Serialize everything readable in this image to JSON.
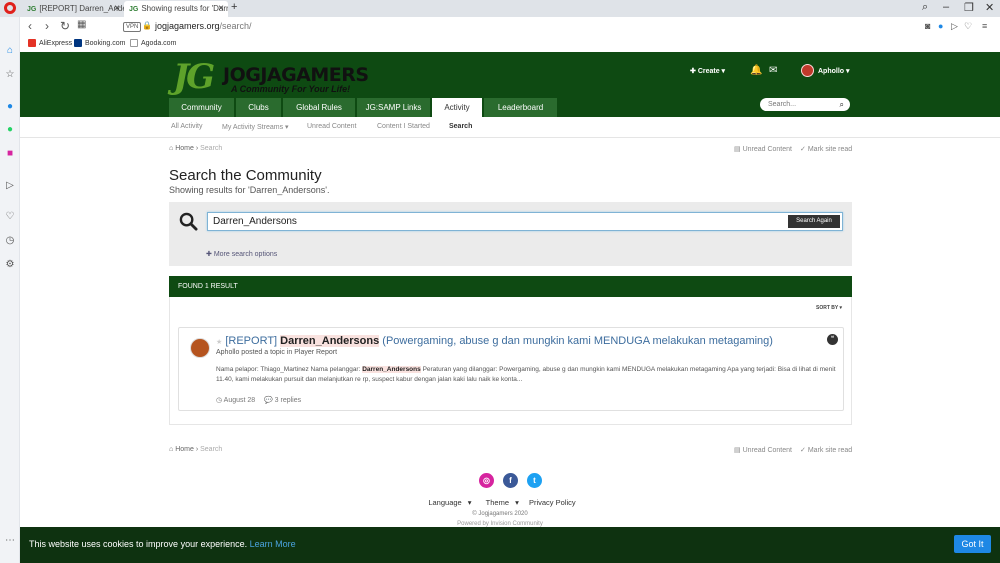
{
  "browser": {
    "tabs": [
      {
        "title": "[REPORT] Darren_Anderso"
      },
      {
        "title": "Showing results for 'Darre"
      }
    ],
    "new_tab": "+",
    "address": {
      "vpn": "VPN",
      "domain": "jogjagamers.org",
      "path": "/search/"
    },
    "bookmarks": [
      "AliExpress",
      "Booking.com",
      "Agoda.com"
    ]
  },
  "site": {
    "logo_mark": "JG",
    "logo_name": "JOGJAGAMERS",
    "logo_tagline": "A Community For Your Life!",
    "create_label": "Create",
    "username": "Aphollo",
    "nav_tabs": [
      "Community",
      "Clubs",
      "Global Rules",
      "JG:SAMP Links",
      "Activity",
      "Leaderboard"
    ],
    "active_tab": "Activity",
    "search_placeholder": "Search...",
    "subnav": [
      "All Activity",
      "My Activity Streams",
      "Unread Content",
      "Content I Started",
      "Search"
    ],
    "active_subnav": "Search"
  },
  "page": {
    "breadcrumb_home": "Home",
    "breadcrumb_current": "Search",
    "unread_content": "Unread Content",
    "mark_site_read": "Mark site read",
    "title": "Search the Community",
    "subtitle": "Showing results for 'Darren_Andersons'.",
    "search_value": "Darren_Andersons",
    "search_again": "Search Again",
    "more_options": "More search options",
    "found_label": "FOUND 1 RESULT",
    "sort_label": "SORT BY"
  },
  "result": {
    "prefix": "[REPORT]",
    "highlight": "Darren_Andersons",
    "title_rest": "(Powergaming, abuse g dan mungkin kami MENDUGA melakukan metagaming)",
    "meta": "Aphollo posted a topic in Player Report",
    "snippet_before": "Nama pelapor: Thiago_Martinez Nama pelanggar:",
    "snippet_highlight": "Darren_Andersons",
    "snippet_after": "Peraturan yang dilanggar: Powergaming, abuse g dan mungkin kami MENDUGA melakukan metagaming Apa yang terjadi: Bisa di lihat di menit 11.40, kami melakukan pursuit dan melanjutkan re rp, suspect kabur dengan jalan kaki lalu naik ke konta...",
    "date": "August 28",
    "replies": "3 replies"
  },
  "footer": {
    "language": "Language",
    "theme": "Theme",
    "privacy": "Privacy Policy",
    "copyright": "© Jogjagamers 2020",
    "powered": "Powered by Invision Community"
  },
  "cookie": {
    "text": "This website uses cookies to improve your experience.",
    "link": "Learn More",
    "button": "Got It"
  },
  "colors": {
    "brand_green": "#0e4a12",
    "link_blue": "#3d6d9e",
    "cookie_button": "#1e88e5"
  }
}
